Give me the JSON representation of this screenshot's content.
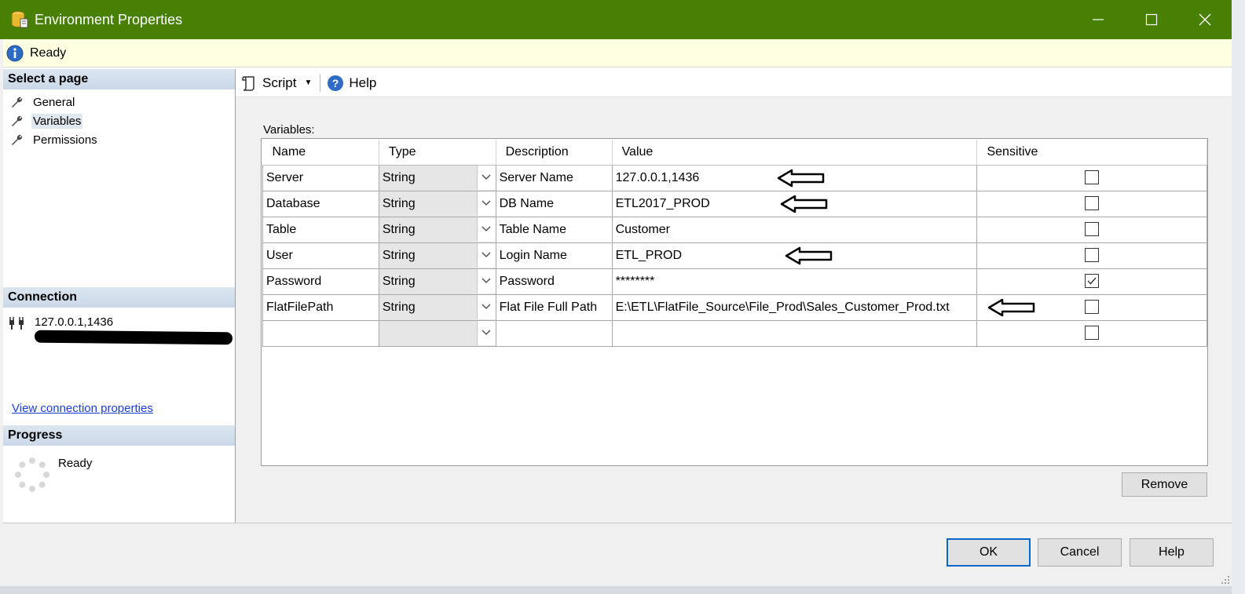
{
  "window": {
    "title": "Environment Properties",
    "minimize_icon": "minimize-icon",
    "maximize_icon": "maximize-icon",
    "close_icon": "close-icon",
    "titlebar_color": "#488003"
  },
  "status": {
    "text": "Ready",
    "icon": "info-icon"
  },
  "left_panel": {
    "select_page_header": "Select a page",
    "pages": [
      {
        "label": "General",
        "selected": false
      },
      {
        "label": "Variables",
        "selected": true
      },
      {
        "label": "Permissions",
        "selected": false
      }
    ],
    "connection_header": "Connection",
    "connection_server": "127.0.0.1,1436",
    "view_connection_link": "View connection properties",
    "progress_header": "Progress",
    "progress_status": "Ready"
  },
  "toolbar": {
    "script_label": "Script",
    "help_label": "Help"
  },
  "variables": {
    "label": "Variables:",
    "columns": [
      "Name",
      "Type",
      "Description",
      "Value",
      "Sensitive"
    ],
    "rows": [
      {
        "name": "Server",
        "type": "String",
        "description": "Server Name",
        "value": "127.0.0.1,1436",
        "sensitive": false,
        "arrow": true
      },
      {
        "name": "Database",
        "type": "String",
        "description": "DB Name",
        "value": "ETL2017_PROD",
        "sensitive": false,
        "arrow": true
      },
      {
        "name": "Table",
        "type": "String",
        "description": "Table Name",
        "value": "Customer",
        "sensitive": false,
        "arrow": false
      },
      {
        "name": "User",
        "type": "String",
        "description": "Login Name",
        "value": "ETL_PROD",
        "sensitive": false,
        "arrow": true
      },
      {
        "name": "Password",
        "type": "String",
        "description": "Password",
        "value": "********",
        "sensitive": true,
        "arrow": false
      },
      {
        "name": "FlatFilePath",
        "type": "String",
        "description": "Flat File Full Path",
        "value": "E:\\ETL\\FlatFile_Source\\File_Prod\\Sales_Customer_Prod.txt",
        "sensitive": false,
        "arrow": true
      },
      {
        "name": "",
        "type": "",
        "description": "",
        "value": "",
        "sensitive": false,
        "arrow": false
      }
    ]
  },
  "buttons": {
    "remove": "Remove",
    "ok": "OK",
    "cancel": "Cancel",
    "help": "Help"
  }
}
